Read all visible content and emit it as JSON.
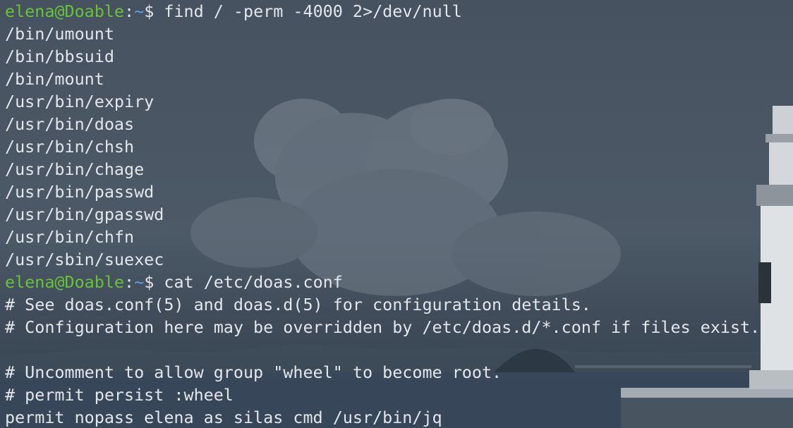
{
  "prompt": {
    "user_host": "elena@Doable",
    "colon": ":",
    "cwd": "~",
    "symbol": "$ "
  },
  "colors": {
    "user_host": "#67c23a",
    "cwd": "#5aa0e6",
    "text": "#e3e6ea"
  },
  "lines": [
    {
      "type": "prompt",
      "command": "find / -perm -4000 2>/dev/null"
    },
    {
      "type": "output",
      "text": "/bin/umount"
    },
    {
      "type": "output",
      "text": "/bin/bbsuid"
    },
    {
      "type": "output",
      "text": "/bin/mount"
    },
    {
      "type": "output",
      "text": "/usr/bin/expiry"
    },
    {
      "type": "output",
      "text": "/usr/bin/doas"
    },
    {
      "type": "output",
      "text": "/usr/bin/chsh"
    },
    {
      "type": "output",
      "text": "/usr/bin/chage"
    },
    {
      "type": "output",
      "text": "/usr/bin/passwd"
    },
    {
      "type": "output",
      "text": "/usr/bin/gpasswd"
    },
    {
      "type": "output",
      "text": "/usr/bin/chfn"
    },
    {
      "type": "output",
      "text": "/usr/sbin/suexec"
    },
    {
      "type": "prompt",
      "command": "cat /etc/doas.conf"
    },
    {
      "type": "output",
      "text": "# See doas.conf(5) and doas.d(5) for configuration details."
    },
    {
      "type": "output",
      "text": "# Configuration here may be overridden by /etc/doas.d/*.conf if files exist."
    },
    {
      "type": "output",
      "text": ""
    },
    {
      "type": "output",
      "text": "# Uncomment to allow group \"wheel\" to become root."
    },
    {
      "type": "output",
      "text": "# permit persist :wheel"
    },
    {
      "type": "output",
      "text": "permit nopass elena as silas cmd /usr/bin/jq"
    }
  ]
}
